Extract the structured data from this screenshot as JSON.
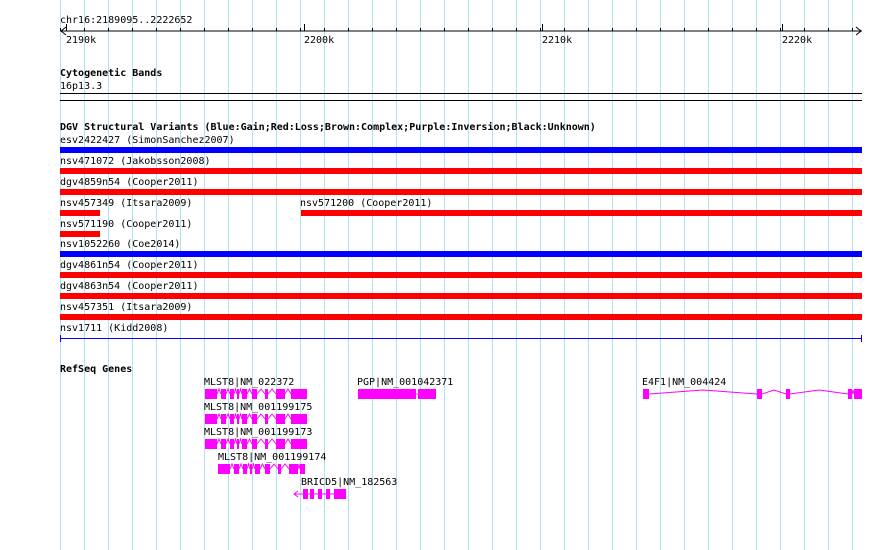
{
  "colors": {
    "grid": "#b3e0f0",
    "gain": "#0000ff",
    "loss": "#ff0000",
    "gene": "#ff00ff"
  },
  "ruler": {
    "region": "chr16:2189095..2222652",
    "ticks": [
      "2190k",
      "2200k",
      "2210k",
      "2220k"
    ]
  },
  "cytoband": {
    "title": "Cytogenetic Bands",
    "band": "16p13.3"
  },
  "dgv": {
    "title": "DGV Structural Variants (Blue:Gain;Red:Loss;Brown:Complex;Purple:Inversion;Black:Unknown)",
    "variants": [
      {
        "label": "esv2422427 (SimonSanchez2007)",
        "type": "gain"
      },
      {
        "label": "nsv471072 (Jakobsson2008)",
        "type": "loss"
      },
      {
        "label": "dgv4859n54 (Cooper2011)",
        "type": "loss"
      },
      {
        "label": "nsv457349 (Itsara2009)",
        "type": "loss"
      },
      {
        "label": "nsv571200 (Cooper2011)",
        "type": "loss"
      },
      {
        "label": "nsv571190 (Cooper2011)",
        "type": "loss"
      },
      {
        "label": "nsv1052260 (Coe2014)",
        "type": "gain"
      },
      {
        "label": "dgv4861n54 (Cooper2011)",
        "type": "loss"
      },
      {
        "label": "dgv4863n54 (Cooper2011)",
        "type": "loss"
      },
      {
        "label": "nsv457351 (Itsara2009)",
        "type": "loss"
      },
      {
        "label": "nsv1711 (Kidd2008)",
        "type": "unknown"
      }
    ]
  },
  "refseq": {
    "title": "RefSeq Genes",
    "genes": [
      {
        "label": "MLST8|NM_022372"
      },
      {
        "label": "MLST8|NM_001199175"
      },
      {
        "label": "MLST8|NM_001199173"
      },
      {
        "label": "MLST8|NM_001199174"
      },
      {
        "label": "BRICD5|NM_182563"
      },
      {
        "label": "PGP|NM_001042371"
      },
      {
        "label": "E4F1|NM_004424"
      }
    ]
  }
}
